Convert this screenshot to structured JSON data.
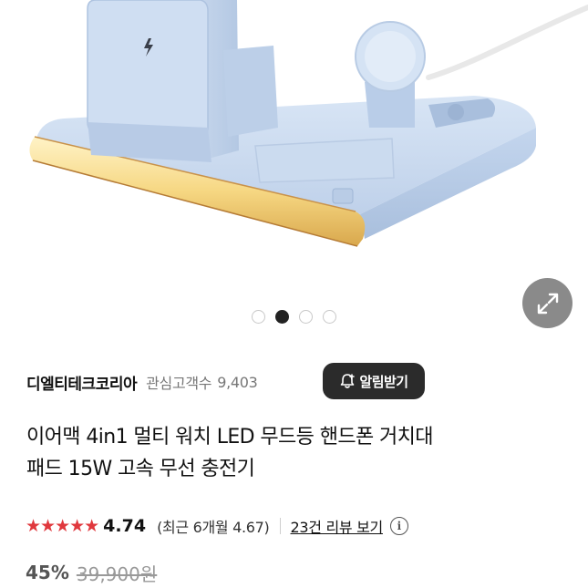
{
  "gallery": {
    "dot_count": 4,
    "active_index": 1
  },
  "seller": {
    "name": "디엘티테크코리아",
    "followers_label": "관심고객수",
    "followers_count": "9,403",
    "alarm_button": "알림받기"
  },
  "product": {
    "title_line1": "이어맥 4in1 멀티 워치 LED 무드등 핸드폰 거치대",
    "title_line2": "패드 15W 고속 무선 충전기"
  },
  "rating": {
    "stars": "★★★★★",
    "value": "4.74",
    "recent": "(최근 6개월 4.67)",
    "reviews_link": "23건 리뷰 보기",
    "info": "i"
  },
  "price": {
    "discount": "45%",
    "original": "39,900원"
  },
  "colors": {
    "accent_red": "#e0383d",
    "dark_button": "#2b2b2b",
    "product_blue": "#c9d9ef",
    "led_gold": "#f3d27a"
  },
  "icons": {
    "expand": "expand-arrows-icon",
    "bell": "bell-plus-icon",
    "lightning": "lightning-icon"
  }
}
